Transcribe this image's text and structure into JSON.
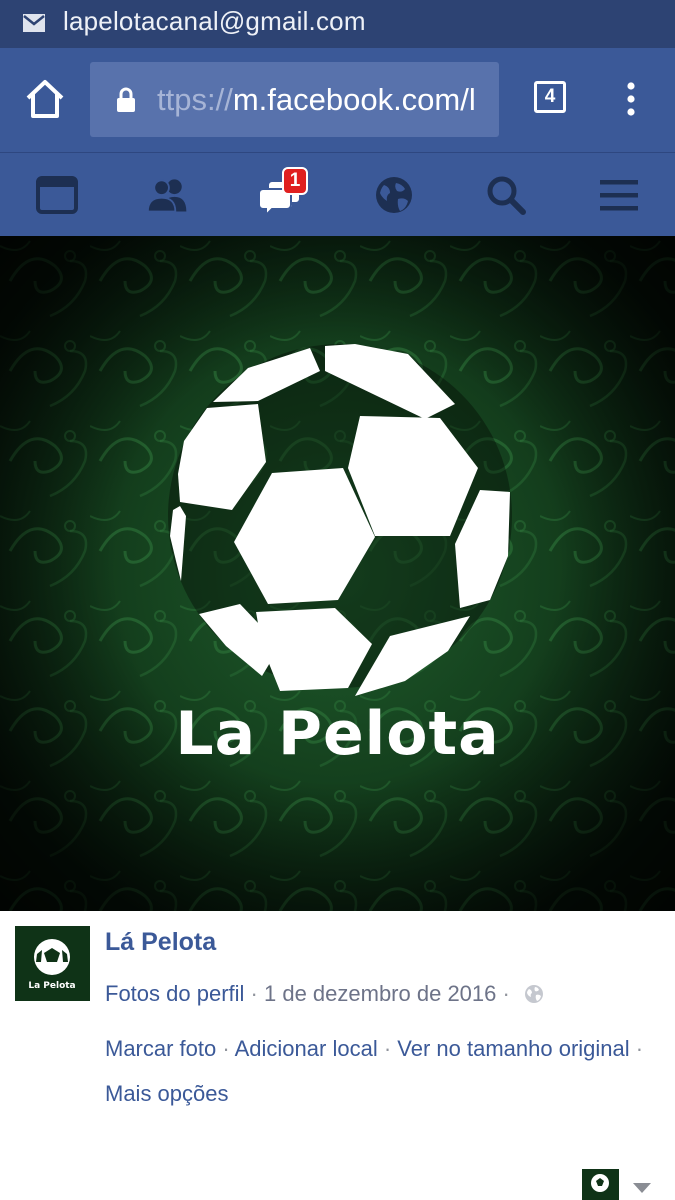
{
  "status_bar": {
    "email": "lapelotacanal@gmail.com"
  },
  "browser": {
    "url_prefix": "ttps://",
    "url_main": "m.facebook.com/l",
    "tab_count": "4"
  },
  "fb_nav": {
    "notification_badge": "1",
    "icons": [
      "news-feed-icon",
      "friends-icon",
      "messages-icon",
      "globe-icon",
      "search-icon",
      "hamburger-menu-icon"
    ]
  },
  "photo": {
    "brand_text": "La Pelota"
  },
  "post": {
    "page_name": "Lá Pelota",
    "album": "Fotos do perfil",
    "date": "1 de dezembro de 2016",
    "actions": [
      "Marcar foto",
      "Adicionar local",
      "Ver no tamanho original",
      "Mais opções"
    ],
    "separator": "·"
  },
  "colors": {
    "status_bar": "#2d4373",
    "facebook_blue": "#3b5998",
    "url_box": "#5872ac",
    "badge_red": "#e02020",
    "photo_green": "#1f5c2c"
  }
}
